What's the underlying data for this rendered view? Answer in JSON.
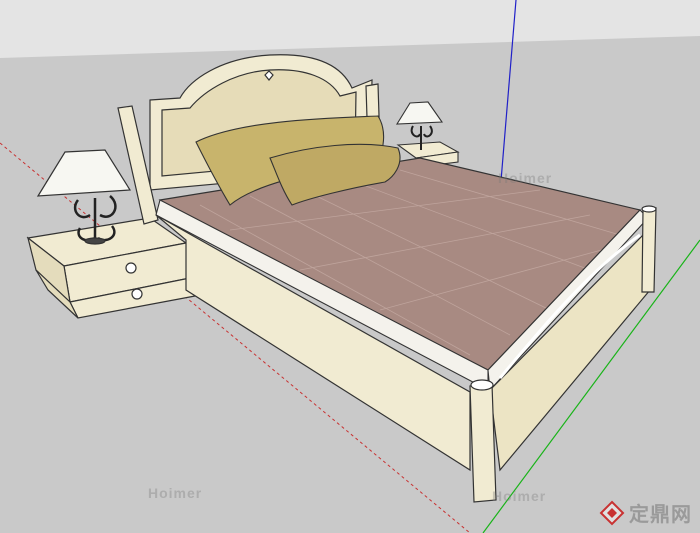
{
  "viewport": {
    "sky_color": "#e4e4e4",
    "ground_color": "#c9c9c9",
    "axis_colors": {
      "blue": "#2020c8",
      "green": "#19b419",
      "red": "#c83232"
    }
  },
  "objects": {
    "bed": {
      "bedspread_color": "#a88a82",
      "frame_color": "#f1ebd2",
      "pillow_color": "#c8b46c"
    },
    "nightstand_left": {
      "color": "#f1ebd2"
    },
    "nightstand_right": {
      "color": "#f1ebd2"
    },
    "lamp_left": {
      "shade_color": "#f7f7f2"
    },
    "lamp_right": {
      "shade_color": "#f7f7f2"
    }
  },
  "watermarks": {
    "top": "Hoimer",
    "bottom_left": "Hoimer",
    "bottom_mid": "Hoimer"
  },
  "brand": {
    "text": "定鼎网",
    "icon": "diamond-logo-icon"
  }
}
